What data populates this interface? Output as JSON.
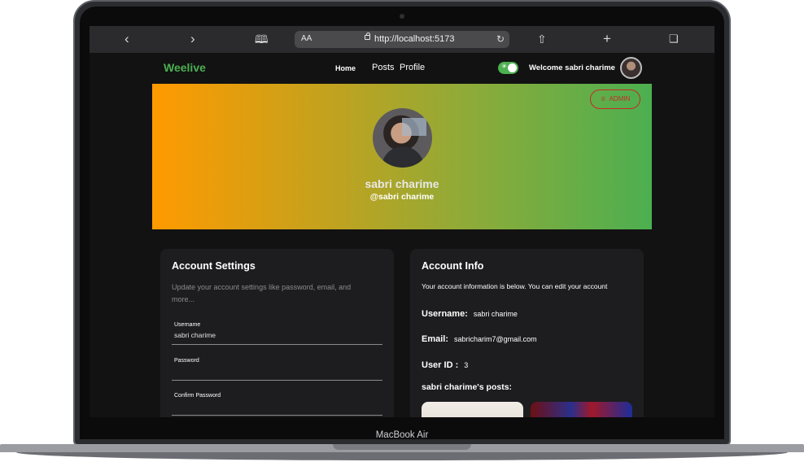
{
  "device": {
    "label": "MacBook Air"
  },
  "browser": {
    "text_size": "AA",
    "url": "http://localhost:5173",
    "icons": [
      "chevron-left-icon",
      "chevron-right-icon",
      "book-icon",
      "lock-icon",
      "reload-icon",
      "share-icon",
      "plus-icon",
      "tabs-icon"
    ]
  },
  "nav": {
    "brand": "Weelive",
    "links": {
      "home": "Home",
      "posts": "Posts",
      "profile": "Profile"
    },
    "toggle_on": true,
    "welcome": "Welcome sabri charime"
  },
  "profile": {
    "badge": "ADMIN",
    "name": "sabri charime",
    "handle": "@sabri charime"
  },
  "account_settings": {
    "title": "Account Settings",
    "description": "Update your account settings like password, email, and more...",
    "fields": [
      {
        "label": "Username",
        "value": "sabri charime"
      },
      {
        "label": "Password",
        "value": ""
      },
      {
        "label": "Confirm Password",
        "value": ""
      }
    ]
  },
  "account_info": {
    "title": "Account Info",
    "description": "Your account information is below. You can edit your account",
    "rows": [
      {
        "key": "Username:",
        "value": "sabri charime"
      },
      {
        "key": "Email:",
        "value": "sabricharim7@gmail.com"
      },
      {
        "key": "User ID :",
        "value": "3"
      }
    ],
    "posts_title": "sabri charime's posts:"
  },
  "colors": {
    "brand_green": "#4caf50",
    "admin_red": "#c62828",
    "gradient_start": "#ff9a00",
    "gradient_end": "#4caf50"
  }
}
